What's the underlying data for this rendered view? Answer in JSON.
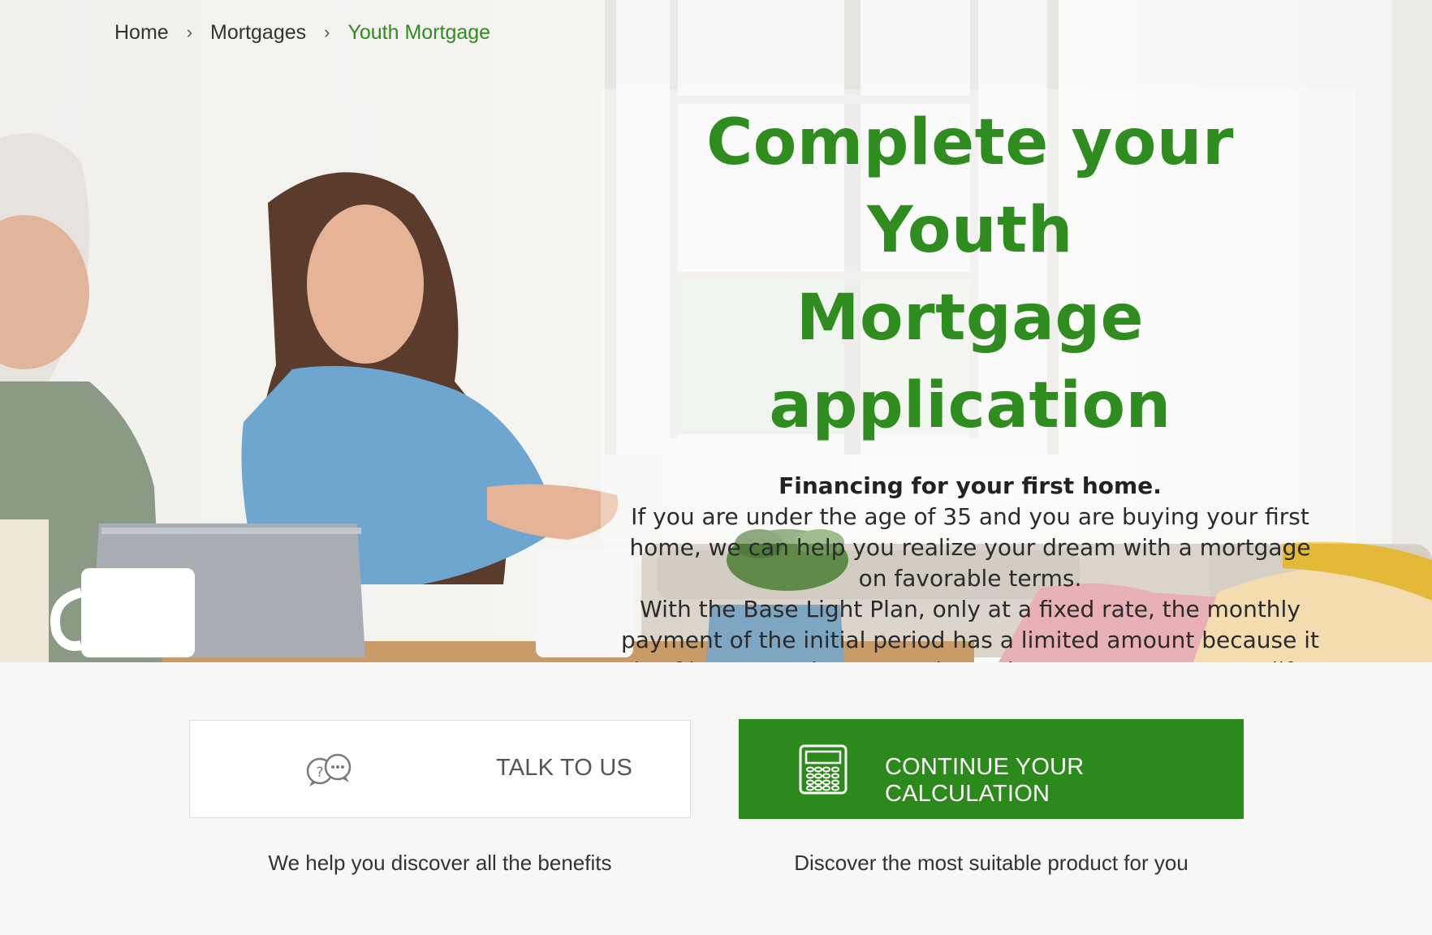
{
  "breadcrumb": {
    "items": [
      "Home",
      "Mortgages",
      "Youth Mortgage"
    ]
  },
  "hero": {
    "title_line1": "Complete your Youth",
    "title_line2": "Mortgage application",
    "subtitle": "Financing for your first home.",
    "paragraph1": "If you are under the age of 35 and you are buying your first home, we can help you realize your dream with a mortgage on favorable terms.",
    "paragraph2": "With the Base Light Plan, only at a fixed rate, the monthly payment of the initial period has a limited amount because it is of interest only, so you do not have to postpone your life projects."
  },
  "cta": {
    "talk_label": "TALK TO US",
    "talk_icon": "chat-bubbles-icon",
    "talk_caption": "We help you discover all the benefits",
    "calc_label": "CONTINUE YOUR CALCULATION",
    "calc_icon": "calculator-icon",
    "calc_caption": "Discover the most suitable product for you"
  },
  "colors": {
    "brand_green": "#2f8c1f",
    "button_green": "#2c8a1c",
    "page_background": "#f7f7f7"
  }
}
